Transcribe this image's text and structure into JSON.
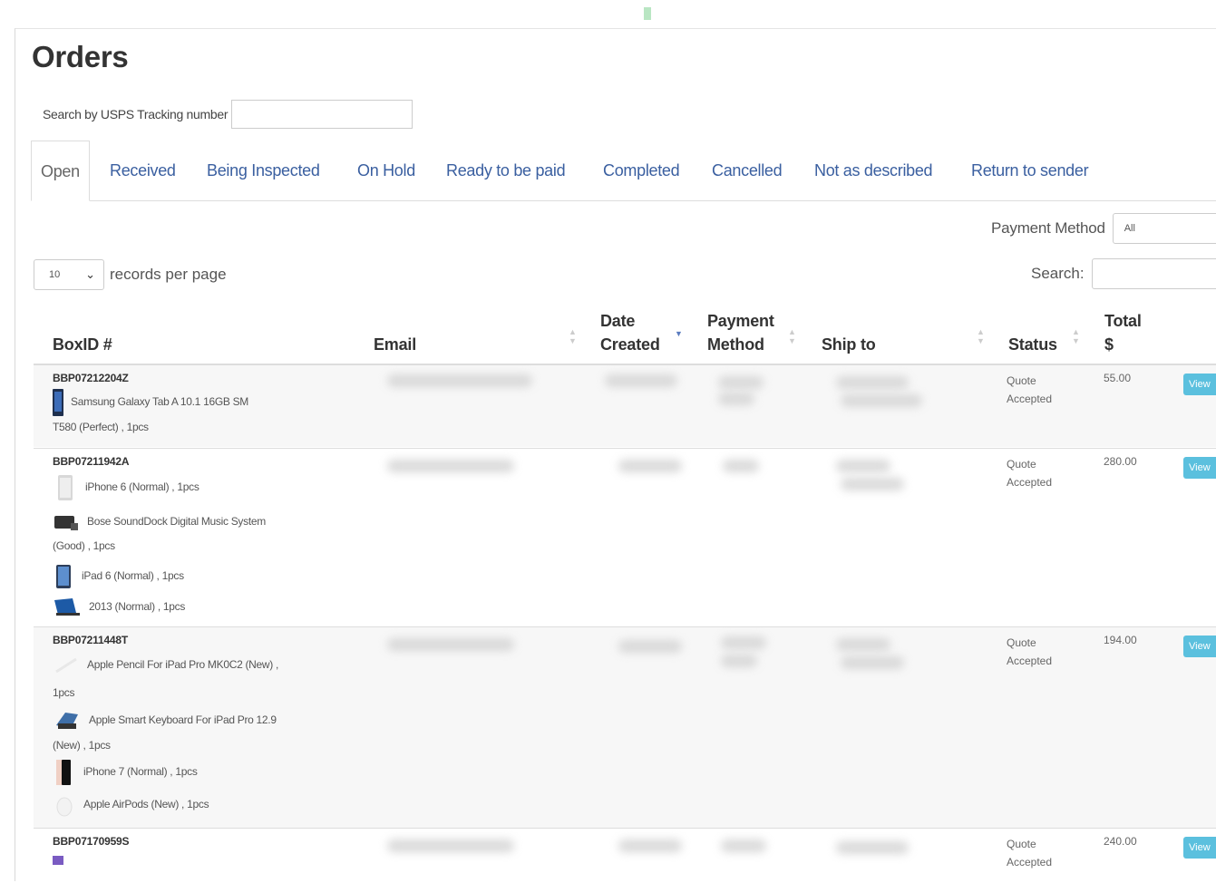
{
  "page": {
    "title": "Orders"
  },
  "usps_search": {
    "label": "Search by USPS Tracking number",
    "value": ""
  },
  "tabs": [
    {
      "label": "Open",
      "active": true
    },
    {
      "label": "Received"
    },
    {
      "label": "Being Inspected"
    },
    {
      "label": "On Hold"
    },
    {
      "label": "Ready to be paid"
    },
    {
      "label": "Completed"
    },
    {
      "label": "Cancelled"
    },
    {
      "label": "Not as described"
    },
    {
      "label": "Return to sender"
    }
  ],
  "payment_filter": {
    "label": "Payment Method",
    "selected": "All"
  },
  "pagination": {
    "per_page": "10",
    "label": "records per page"
  },
  "table_search": {
    "label": "Search:",
    "value": ""
  },
  "columns": {
    "boxid": "BoxID #",
    "email": "Email",
    "date_1": "Date",
    "date_2": "Created",
    "pay_1": "Payment",
    "pay_2": "Method",
    "ship": "Ship to",
    "status": "Status",
    "total_1": "Total",
    "total_2": "$"
  },
  "orders": [
    {
      "boxid": "BBP07212204Z",
      "items": [
        {
          "l1": "Samsung Galaxy Tab A 10.1 16GB SM",
          "l2": "T580 (Perfect) , 1pcs",
          "icon": "tablet-icon"
        }
      ],
      "status_1": "Quote",
      "status_2": "Accepted",
      "total": "55.00",
      "action": "View"
    },
    {
      "boxid": "BBP07211942A",
      "items": [
        {
          "l1": "iPhone 6 (Normal) , 1pcs",
          "icon": "phone-icon"
        },
        {
          "l1": "Bose SoundDock Digital Music System",
          "l2": "(Good) , 1pcs",
          "icon": "speaker-icon"
        },
        {
          "l1": "iPad 6 (Normal) , 1pcs",
          "icon": "tablet-icon"
        },
        {
          "l1": "2013 (Normal) , 1pcs",
          "icon": "laptop-icon"
        }
      ],
      "status_1": "Quote",
      "status_2": "Accepted",
      "total": "280.00",
      "action": "View"
    },
    {
      "boxid": "BBP07211448T",
      "items": [
        {
          "l1": "Apple Pencil For iPad Pro MK0C2 (New) ,",
          "l2": "1pcs",
          "icon": "pencil-icon"
        },
        {
          "l1": "Apple Smart Keyboard For iPad Pro 12.9",
          "l2": "(New) , 1pcs",
          "icon": "keyboard-icon"
        },
        {
          "l1": "iPhone 7 (Normal) , 1pcs",
          "icon": "phone-icon"
        },
        {
          "l1": "Apple AirPods (New) , 1pcs",
          "icon": "airpods-icon"
        }
      ],
      "status_1": "Quote",
      "status_2": "Accepted",
      "total": "194.00",
      "action": "View"
    },
    {
      "boxid": "BBP07170959S",
      "items": [],
      "status_1": "Quote",
      "status_2": "Accepted",
      "total": "240.00",
      "action": "View"
    }
  ]
}
